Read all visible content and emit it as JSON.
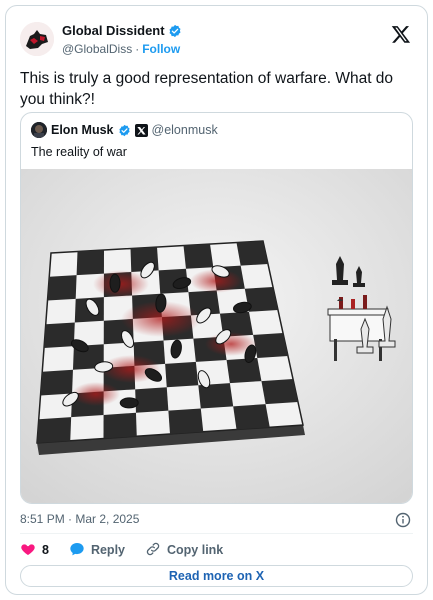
{
  "author": {
    "name": "Global Dissident",
    "handle": "@GlobalDiss",
    "follow_label": "Follow"
  },
  "tweet": {
    "text": "This is truly a good representation of warfare. What do you think?!"
  },
  "quoted": {
    "name": "Elon Musk",
    "handle": "@elonmusk",
    "text": "The reality of war"
  },
  "meta": {
    "timestamp": "8:51 PM · Mar 2, 2025"
  },
  "actions": {
    "like_count": "8",
    "reply_label": "Reply",
    "copy_link_label": "Copy link"
  },
  "read_more_label": "Read more on X",
  "colors": {
    "accent": "#1d9bf0",
    "like": "#f91880",
    "reply": "#1d9bf0",
    "link": "#1d63b3"
  },
  "icons": [
    "verified-badge-icon",
    "x-logo-icon",
    "info-icon",
    "heart-icon",
    "reply-bubble-icon",
    "link-icon"
  ]
}
